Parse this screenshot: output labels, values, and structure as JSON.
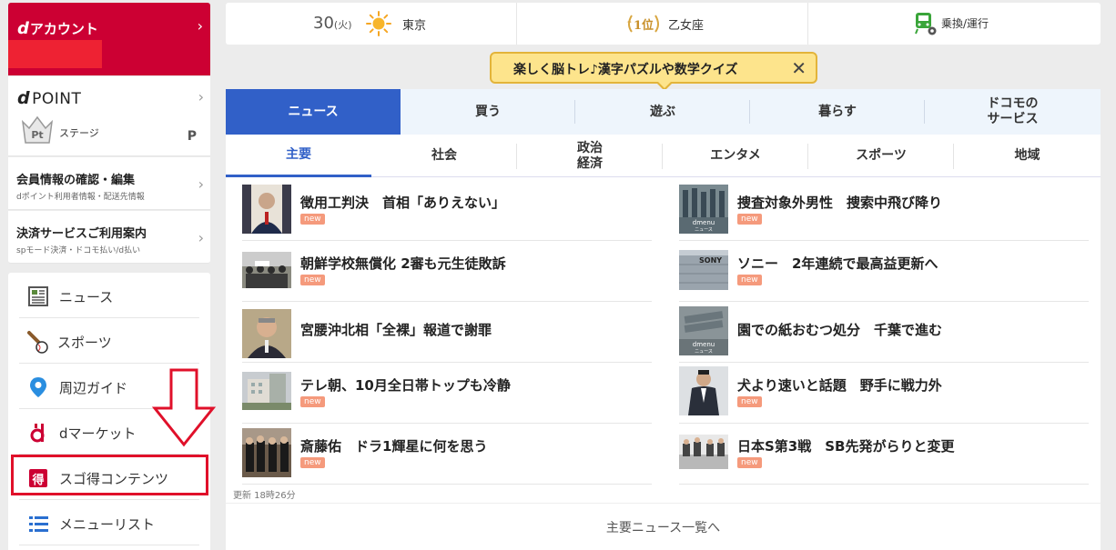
{
  "account": {
    "title": "アカウント",
    "d_mark": "d"
  },
  "point": {
    "brand": "POINT",
    "d_mark": "d",
    "stage_label": "ステージ",
    "point_unit": "P",
    "rank_icon": "Pt"
  },
  "account_links": [
    {
      "title": "会員情報の確認・編集",
      "sub": "dポイント利用者情報・配送先情報"
    },
    {
      "title": "決済サービスご利用案内",
      "sub": "spモード決済・ドコモ払い/d払い"
    }
  ],
  "menu": [
    {
      "label": "ニュース",
      "icon": "newspaper-icon"
    },
    {
      "label": "スポーツ",
      "icon": "baseball-icon"
    },
    {
      "label": "周辺ガイド",
      "icon": "map-pin-icon"
    },
    {
      "label": "dマーケット",
      "icon": "dmarket-icon"
    },
    {
      "label": "スゴ得コンテンツ",
      "icon": "sugotoku-icon"
    },
    {
      "label": "メニューリスト",
      "icon": "list-icon"
    }
  ],
  "info": {
    "temp": "30",
    "day": "(火)",
    "city": "東京",
    "rank": "1位",
    "zodiac": "乙女座",
    "transit": "乗換/運行"
  },
  "banner": {
    "text": "楽しく脳トレ♪漢字パズルや数学クイズ",
    "close": "✕"
  },
  "categories": [
    {
      "label": "ニュース",
      "active": true
    },
    {
      "label": "買う"
    },
    {
      "label": "遊ぶ"
    },
    {
      "label": "暮らす"
    },
    {
      "label": "ドコモの\nサービス"
    }
  ],
  "subcategories": [
    {
      "label": "主要",
      "active": true
    },
    {
      "label": "社会"
    },
    {
      "label": "政治\n経済"
    },
    {
      "label": "エンタメ"
    },
    {
      "label": "スポーツ"
    },
    {
      "label": "地域"
    }
  ],
  "articles_left": [
    {
      "headline": "徴用工判決　首相「ありえない」",
      "badge": "new",
      "thumb": "person"
    },
    {
      "headline": "朝鮮学校無償化 2審も元生徒敗訴",
      "badge": "new",
      "thumb": "crowd"
    },
    {
      "headline": "宮腰沖北相「全裸」報道で謝罪",
      "badge": "",
      "thumb": "person"
    },
    {
      "headline": "テレ朝、10月全日帯トップも冷静",
      "badge": "new",
      "thumb": "building"
    },
    {
      "headline": "斎藤佑　ドラ1輝星に何を思う",
      "badge": "new",
      "thumb": "group"
    }
  ],
  "articles_right": [
    {
      "headline": "捜査対象外男性　捜索中飛び降り",
      "badge": "new",
      "thumb": "dmenu",
      "thumb_text": "dmenu\nニュース"
    },
    {
      "headline": "ソニー　2年連続で最高益更新へ",
      "badge": "new",
      "thumb": "sony",
      "thumb_text": "SONY"
    },
    {
      "headline": "園での紙おむつ処分　千葉で進む",
      "badge": "",
      "thumb": "dmenu",
      "thumb_text": "dmenu\nニュース"
    },
    {
      "headline": "犬より速いと話題　野手に戦力外",
      "badge": "new",
      "thumb": "player"
    },
    {
      "headline": "日本S第3戦　SB先発がらりと変更",
      "badge": "new",
      "thumb": "press"
    }
  ],
  "updated": "更新 18時26分",
  "more_link": "主要ニュース一覧へ",
  "colors": {
    "docomo_red": "#cc0033",
    "accent_blue": "#3160c8",
    "new_badge": "#f59a7c",
    "annotation_red": "#e0102a"
  }
}
